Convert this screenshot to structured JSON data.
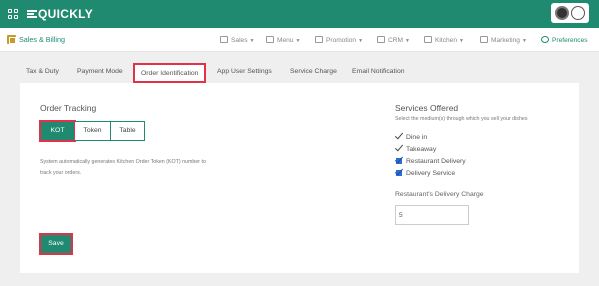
{
  "app": {
    "logo": "QUICKLY"
  },
  "subnav": {
    "brand": "Sales & Billing",
    "items": [
      {
        "label": "Sales",
        "icon": "monitor-icon"
      },
      {
        "label": "Menu",
        "icon": "menu-icon"
      },
      {
        "label": "Promotion",
        "icon": "tag-icon"
      },
      {
        "label": "CRM",
        "icon": "users-icon"
      },
      {
        "label": "Kitchen",
        "icon": "chef-icon"
      },
      {
        "label": "Marketing",
        "icon": "megaphone-icon"
      },
      {
        "label": "Preferences",
        "icon": "gear-icon"
      }
    ]
  },
  "tabs": [
    {
      "label": "Tax & Duty"
    },
    {
      "label": "Payment Mode"
    },
    {
      "label": "Order Identification"
    },
    {
      "label": "App User Settings"
    },
    {
      "label": "Service Charge"
    },
    {
      "label": "Email Notification"
    }
  ],
  "order_tracking": {
    "title": "Order Tracking",
    "options": [
      "KOT",
      "Token",
      "Table"
    ],
    "selected": "KOT",
    "description": "System automatically generates Kitchen Order Token (KOT) number to track your orders.",
    "save_label": "Save"
  },
  "services": {
    "title": "Services Offered",
    "subtitle": "Select the medium(s) through which you sell your dishes",
    "items": [
      {
        "label": "Dine in",
        "checked": true
      },
      {
        "label": "Takeaway",
        "checked": true
      },
      {
        "label": "Restaurant Delivery",
        "checked": true
      },
      {
        "label": "Delivery Service",
        "checked": true
      }
    ],
    "delivery_charge_label": "Restaurant's Delivery Charge",
    "delivery_charge_value": "5"
  },
  "colors": {
    "primary": "#1f8a70",
    "highlight": "#e0334a",
    "checkbox": "#2d6ed0"
  }
}
